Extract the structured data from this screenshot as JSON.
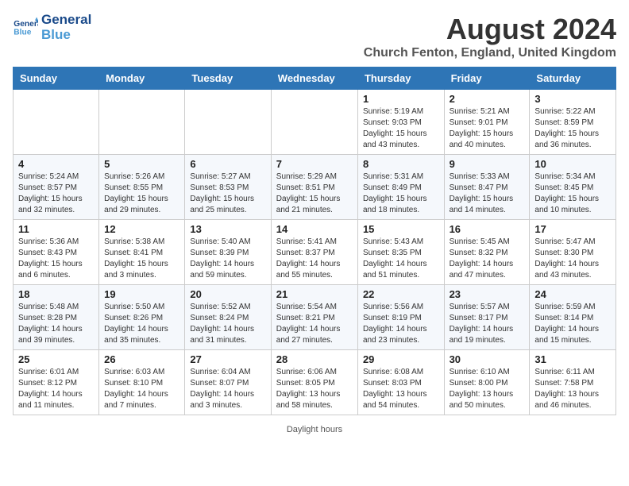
{
  "header": {
    "logo_line1": "General",
    "logo_line2": "Blue",
    "main_title": "August 2024",
    "subtitle": "Church Fenton, England, United Kingdom"
  },
  "weekdays": [
    "Sunday",
    "Monday",
    "Tuesday",
    "Wednesday",
    "Thursday",
    "Friday",
    "Saturday"
  ],
  "weeks": [
    [
      {
        "day": "",
        "info": ""
      },
      {
        "day": "",
        "info": ""
      },
      {
        "day": "",
        "info": ""
      },
      {
        "day": "",
        "info": ""
      },
      {
        "day": "1",
        "info": "Sunrise: 5:19 AM\nSunset: 9:03 PM\nDaylight: 15 hours\nand 43 minutes."
      },
      {
        "day": "2",
        "info": "Sunrise: 5:21 AM\nSunset: 9:01 PM\nDaylight: 15 hours\nand 40 minutes."
      },
      {
        "day": "3",
        "info": "Sunrise: 5:22 AM\nSunset: 8:59 PM\nDaylight: 15 hours\nand 36 minutes."
      }
    ],
    [
      {
        "day": "4",
        "info": "Sunrise: 5:24 AM\nSunset: 8:57 PM\nDaylight: 15 hours\nand 32 minutes."
      },
      {
        "day": "5",
        "info": "Sunrise: 5:26 AM\nSunset: 8:55 PM\nDaylight: 15 hours\nand 29 minutes."
      },
      {
        "day": "6",
        "info": "Sunrise: 5:27 AM\nSunset: 8:53 PM\nDaylight: 15 hours\nand 25 minutes."
      },
      {
        "day": "7",
        "info": "Sunrise: 5:29 AM\nSunset: 8:51 PM\nDaylight: 15 hours\nand 21 minutes."
      },
      {
        "day": "8",
        "info": "Sunrise: 5:31 AM\nSunset: 8:49 PM\nDaylight: 15 hours\nand 18 minutes."
      },
      {
        "day": "9",
        "info": "Sunrise: 5:33 AM\nSunset: 8:47 PM\nDaylight: 15 hours\nand 14 minutes."
      },
      {
        "day": "10",
        "info": "Sunrise: 5:34 AM\nSunset: 8:45 PM\nDaylight: 15 hours\nand 10 minutes."
      }
    ],
    [
      {
        "day": "11",
        "info": "Sunrise: 5:36 AM\nSunset: 8:43 PM\nDaylight: 15 hours\nand 6 minutes."
      },
      {
        "day": "12",
        "info": "Sunrise: 5:38 AM\nSunset: 8:41 PM\nDaylight: 15 hours\nand 3 minutes."
      },
      {
        "day": "13",
        "info": "Sunrise: 5:40 AM\nSunset: 8:39 PM\nDaylight: 14 hours\nand 59 minutes."
      },
      {
        "day": "14",
        "info": "Sunrise: 5:41 AM\nSunset: 8:37 PM\nDaylight: 14 hours\nand 55 minutes."
      },
      {
        "day": "15",
        "info": "Sunrise: 5:43 AM\nSunset: 8:35 PM\nDaylight: 14 hours\nand 51 minutes."
      },
      {
        "day": "16",
        "info": "Sunrise: 5:45 AM\nSunset: 8:32 PM\nDaylight: 14 hours\nand 47 minutes."
      },
      {
        "day": "17",
        "info": "Sunrise: 5:47 AM\nSunset: 8:30 PM\nDaylight: 14 hours\nand 43 minutes."
      }
    ],
    [
      {
        "day": "18",
        "info": "Sunrise: 5:48 AM\nSunset: 8:28 PM\nDaylight: 14 hours\nand 39 minutes."
      },
      {
        "day": "19",
        "info": "Sunrise: 5:50 AM\nSunset: 8:26 PM\nDaylight: 14 hours\nand 35 minutes."
      },
      {
        "day": "20",
        "info": "Sunrise: 5:52 AM\nSunset: 8:24 PM\nDaylight: 14 hours\nand 31 minutes."
      },
      {
        "day": "21",
        "info": "Sunrise: 5:54 AM\nSunset: 8:21 PM\nDaylight: 14 hours\nand 27 minutes."
      },
      {
        "day": "22",
        "info": "Sunrise: 5:56 AM\nSunset: 8:19 PM\nDaylight: 14 hours\nand 23 minutes."
      },
      {
        "day": "23",
        "info": "Sunrise: 5:57 AM\nSunset: 8:17 PM\nDaylight: 14 hours\nand 19 minutes."
      },
      {
        "day": "24",
        "info": "Sunrise: 5:59 AM\nSunset: 8:14 PM\nDaylight: 14 hours\nand 15 minutes."
      }
    ],
    [
      {
        "day": "25",
        "info": "Sunrise: 6:01 AM\nSunset: 8:12 PM\nDaylight: 14 hours\nand 11 minutes."
      },
      {
        "day": "26",
        "info": "Sunrise: 6:03 AM\nSunset: 8:10 PM\nDaylight: 14 hours\nand 7 minutes."
      },
      {
        "day": "27",
        "info": "Sunrise: 6:04 AM\nSunset: 8:07 PM\nDaylight: 14 hours\nand 3 minutes."
      },
      {
        "day": "28",
        "info": "Sunrise: 6:06 AM\nSunset: 8:05 PM\nDaylight: 13 hours\nand 58 minutes."
      },
      {
        "day": "29",
        "info": "Sunrise: 6:08 AM\nSunset: 8:03 PM\nDaylight: 13 hours\nand 54 minutes."
      },
      {
        "day": "30",
        "info": "Sunrise: 6:10 AM\nSunset: 8:00 PM\nDaylight: 13 hours\nand 50 minutes."
      },
      {
        "day": "31",
        "info": "Sunrise: 6:11 AM\nSunset: 7:58 PM\nDaylight: 13 hours\nand 46 minutes."
      }
    ]
  ],
  "footer": {
    "daylight_label": "Daylight hours"
  }
}
